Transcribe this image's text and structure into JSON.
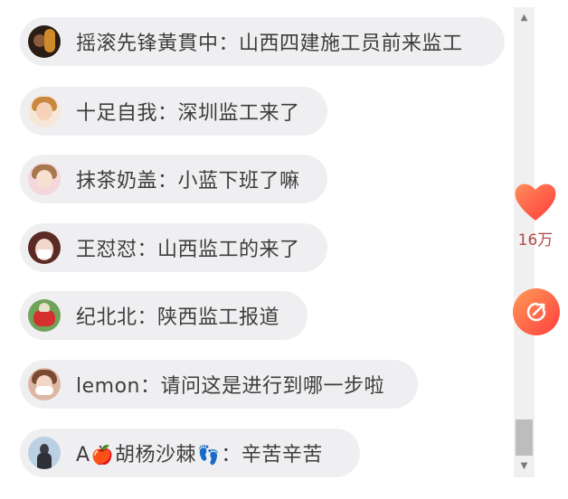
{
  "comments": [
    {
      "user": "摇滚先锋黃貫中",
      "sep": "：",
      "msg": "山西四建施工员前来监工"
    },
    {
      "user": "十足自我",
      "sep": "：",
      "msg": "深圳监工来了"
    },
    {
      "user": "抹茶奶盖",
      "sep": "：",
      "msg": "小蓝下班了嘛"
    },
    {
      "user": "王怼怼",
      "sep": "：",
      "msg": "山西监工的来了"
    },
    {
      "user": "纪北北",
      "sep": "：",
      "msg": "陕西监工报道"
    },
    {
      "user": "lemon",
      "sep": "：",
      "msg": "请问这是进行到哪一步啦"
    },
    {
      "user_a": "A",
      "emoji_1": "🍎",
      "user_b": "胡杨沙棘",
      "emoji_2": "👣",
      "sep": "：",
      "msg": "辛苦辛苦"
    }
  ],
  "like": {
    "count": "16万",
    "icon": "heart-icon",
    "color": "#ff5a47"
  },
  "share": {
    "icon": "share-icon",
    "color": "#ff6a4a"
  },
  "scrollbar": {
    "up": "▲",
    "down": "▼",
    "thumb_fraction": 0.95
  }
}
